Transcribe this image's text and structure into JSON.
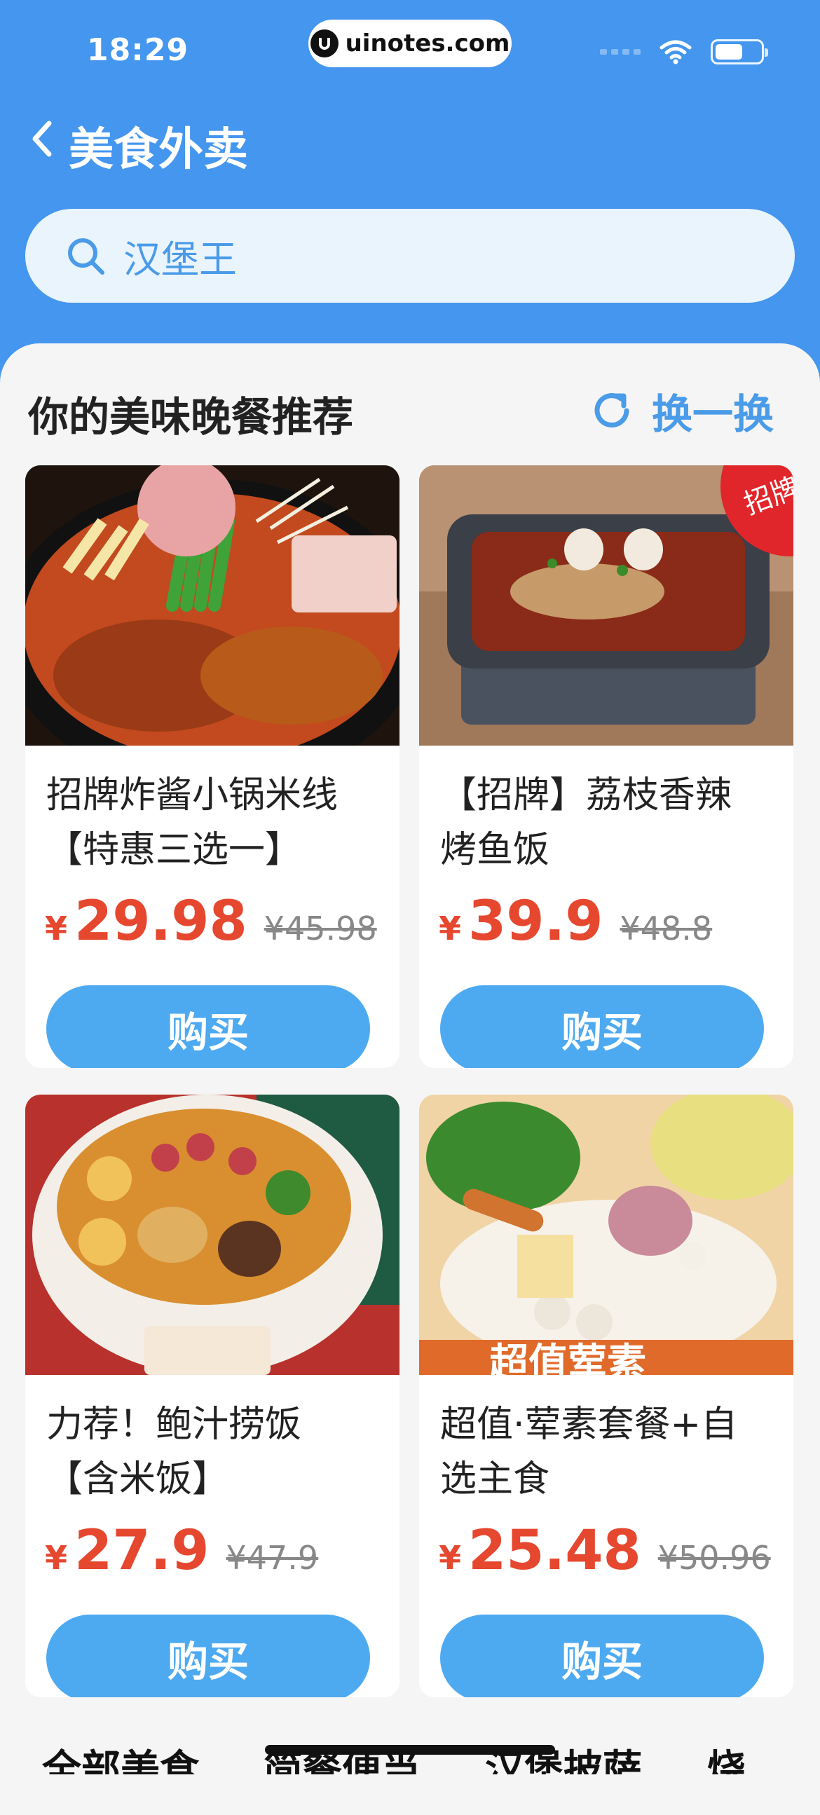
{
  "status": {
    "time": "18:29",
    "url": "uinotes.com"
  },
  "nav": {
    "title": "美食外卖"
  },
  "search": {
    "query": "汉堡王"
  },
  "section": {
    "title": "你的美味晚餐推荐",
    "refresh_label": "换一换"
  },
  "products": [
    {
      "name_line1": "招牌炸酱小锅米线",
      "name_line2": "【特惠三选一】",
      "currency": "¥",
      "price": "29.98",
      "original_price": "¥45.98",
      "buy_label": "购买"
    },
    {
      "name_line1": "【招牌】荔枝香辣",
      "name_line2": "烤鱼饭",
      "currency": "¥",
      "price": "39.9",
      "original_price": "¥48.8",
      "buy_label": "购买",
      "badge": "招牌"
    },
    {
      "name_line1": "力荐！鲍汁捞饭",
      "name_line2": "【含米饭】",
      "currency": "¥",
      "price": "27.9",
      "original_price": "¥47.9",
      "buy_label": "购买"
    },
    {
      "name_line1": "超值·荤素套餐+自",
      "name_line2": "选主食",
      "currency": "¥",
      "price": "25.48",
      "original_price": "¥50.96",
      "buy_label": "购买",
      "image_text": "超值荤素"
    }
  ],
  "tabs": [
    "全部美食",
    "简餐便当",
    "汉堡披萨",
    "烧"
  ],
  "colors": {
    "header": "#4496ee",
    "accent": "#4eaaf0",
    "price": "#e6472f"
  },
  "icons": {
    "back": "chevron-left-icon",
    "search": "search-icon",
    "refresh": "refresh-icon",
    "wifi": "wifi-icon",
    "battery": "battery-icon"
  }
}
